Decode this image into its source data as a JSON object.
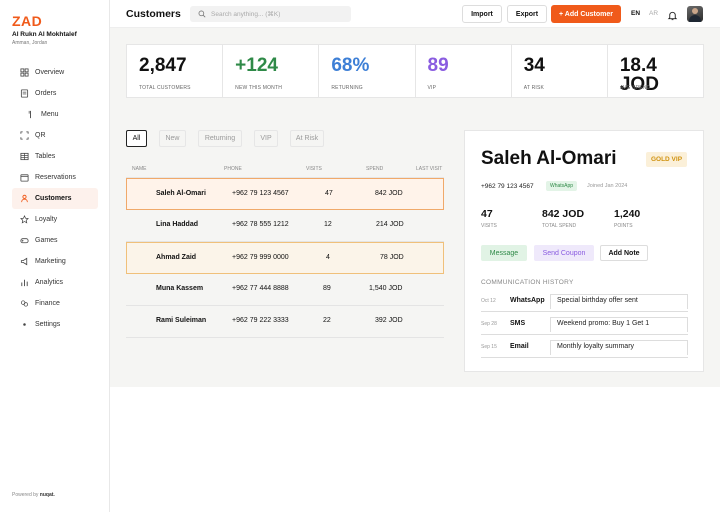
{
  "brand": {
    "logo": "ZAD",
    "business_name": "Al Rukn Al Mokhtalef",
    "location": "Amman, Jordan",
    "accent_color": "#f05a1a",
    "powered_by_prefix": "Powered by",
    "powered_by_name": "nuqat."
  },
  "sidebar": {
    "items": [
      {
        "label": "Overview",
        "icon": "grid-icon"
      },
      {
        "label": "Orders",
        "icon": "receipt-icon"
      },
      {
        "label": "Menu",
        "icon": "fork-icon"
      },
      {
        "label": "QR",
        "icon": "qr-icon"
      },
      {
        "label": "Tables",
        "icon": "table-icon"
      },
      {
        "label": "Reservations",
        "icon": "calendar-icon"
      },
      {
        "label": "Customers",
        "icon": "user-icon",
        "active": true
      },
      {
        "label": "Loyalty",
        "icon": "star-icon"
      },
      {
        "label": "Games",
        "icon": "gamepad-icon"
      },
      {
        "label": "Marketing",
        "icon": "megaphone-icon"
      },
      {
        "label": "Analytics",
        "icon": "chart-icon"
      },
      {
        "label": "Finance",
        "icon": "wallet-icon"
      },
      {
        "label": "Settings",
        "icon": "gear-icon"
      }
    ]
  },
  "header": {
    "title": "Customers",
    "search_placeholder": "Search anything... (⌘K)",
    "import_label": "Import",
    "export_label": "Export",
    "add_label": "+ Add Customer",
    "lang_en": "EN",
    "lang_ar": "AR"
  },
  "stats": [
    {
      "value": "2,847",
      "label": "TOTAL CUSTOMERS",
      "color": "#111111"
    },
    {
      "value": "+124",
      "label": "NEW THIS MONTH",
      "color": "#2f8a48"
    },
    {
      "value": "68%",
      "label": "RETURNING",
      "color": "#3d7fd6"
    },
    {
      "value": "89",
      "label": "VIP",
      "color": "#8a5ce0"
    },
    {
      "value": "34",
      "label": "AT RISK",
      "color": "#111111"
    },
    {
      "value": "18.4 JOD",
      "label": "AVG SPEND",
      "color": "#111111"
    }
  ],
  "filters": [
    "All",
    "New",
    "Returning",
    "VIP",
    "At Risk"
  ],
  "table": {
    "columns": [
      "NAME",
      "PHONE",
      "VISITS",
      "SPEND",
      "LAST VISIT"
    ],
    "rows": [
      {
        "name": "Saleh Al-Omari",
        "phone": "+962 79 123 4567",
        "visits": "47",
        "spend": "842 JOD"
      },
      {
        "name": "Lina Haddad",
        "phone": "+962 78 555 1212",
        "visits": "12",
        "spend": "214 JOD"
      },
      {
        "name": "Ahmad Zaid",
        "phone": "+962 79 999 0000",
        "visits": "4",
        "spend": "78 JOD"
      },
      {
        "name": "Muna Kassem",
        "phone": "+962 77 444 8888",
        "visits": "89",
        "spend": "1,540 JOD"
      },
      {
        "name": "Rami Suleiman",
        "phone": "+962 79 222 3333",
        "visits": "22",
        "spend": "392 JOD"
      }
    ]
  },
  "detail": {
    "name": "Saleh Al-Omari",
    "tier": "GOLD VIP",
    "phone": "+962 79 123 4567",
    "channel": "WhatsApp",
    "joined": "Joined Jan 2024",
    "stats": [
      {
        "value": "47",
        "label": "VISITS"
      },
      {
        "value": "842 JOD",
        "label": "TOTAL SPEND"
      },
      {
        "value": "1,240",
        "label": "POINTS"
      }
    ],
    "buttons": {
      "message": "Message",
      "coupon": "Send Coupon",
      "note": "Add Note"
    },
    "comm_title": "COMMUNICATION HISTORY",
    "comm": [
      {
        "date": "Oct 12",
        "channel": "WhatsApp",
        "message": "Special birthday offer sent"
      },
      {
        "date": "Sep 28",
        "channel": "SMS",
        "message": "Weekend promo: Buy 1 Get 1"
      },
      {
        "date": "Sep 15",
        "channel": "Email",
        "message": "Monthly loyalty summary"
      }
    ]
  }
}
